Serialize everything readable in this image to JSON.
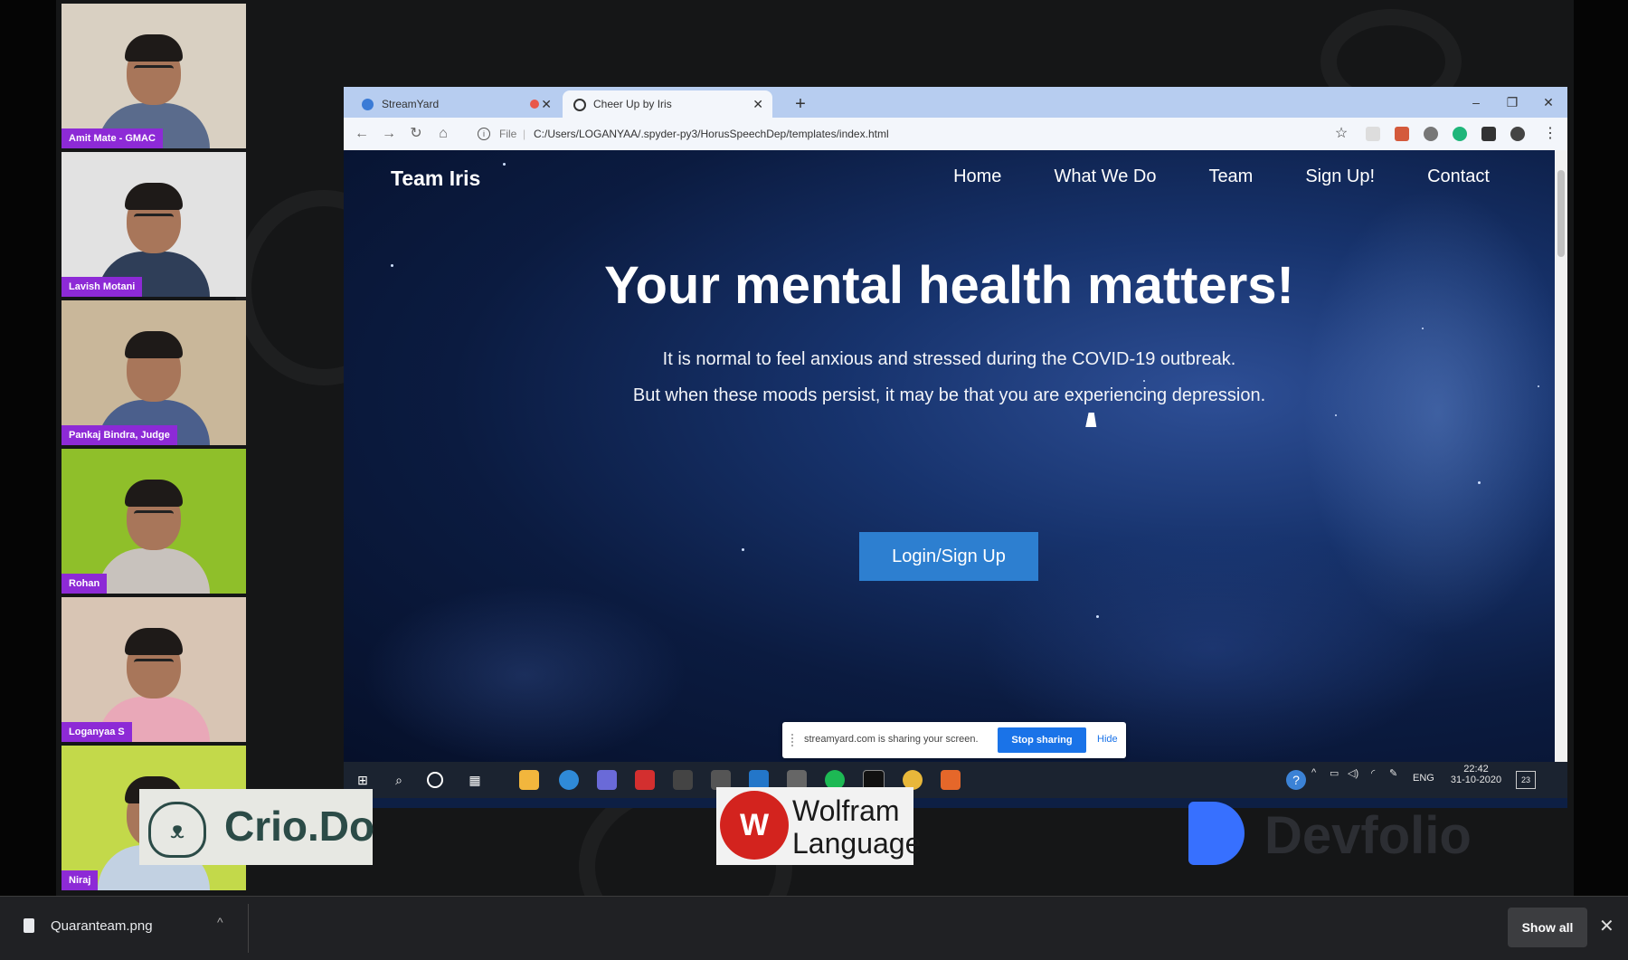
{
  "participants": [
    {
      "name": "Amit Mate - GMAC",
      "bg": "#d9d0c2",
      "shirt": "#5a6b8c"
    },
    {
      "name": "Lavish Motani",
      "bg": "#e2e2e2",
      "shirt": "#2f3e58"
    },
    {
      "name": "Pankaj Bindra, Judge",
      "bg": "#c9b79a",
      "shirt": "#4b5f8c"
    },
    {
      "name": "Rohan",
      "bg": "#8fbf2a",
      "shirt": "#c8c2bd"
    },
    {
      "name": "Loganyaa S",
      "bg": "#d8c5b4",
      "shirt": "#e9a8b8"
    },
    {
      "name": "Niraj",
      "bg": "#c3d94a",
      "shirt": "#c2d1e2"
    }
  ],
  "browser": {
    "tabs": [
      {
        "label": "StreamYard",
        "favicon_color": "#3b7bd6"
      },
      {
        "label": "Cheer Up by Iris",
        "favicon_color": "#333333"
      }
    ],
    "new_tab": "+",
    "window_buttons": {
      "minimize": "–",
      "restore": "❐",
      "close": "✕"
    },
    "nav": {
      "back": "←",
      "forward": "→",
      "reload": "↻",
      "home": "⌂"
    },
    "address": {
      "scheme": "File",
      "separator": "|",
      "url": "C:/Users/LOGANYAA/.spyder-py3/HorusSpeechDep/templates/index.html"
    },
    "star": "☆",
    "menu": "⋮"
  },
  "site": {
    "brand": "Team Iris",
    "nav": [
      "Home",
      "What We Do",
      "Team",
      "Sign Up!",
      "Contact"
    ],
    "hero_title": "Your mental health matters!",
    "hero_line1": "It is normal to feel anxious and stressed during the COVID-19 outbreak.",
    "hero_line2": "But when these moods persist, it may be that you are experiencing depression.",
    "cta": "Login/Sign Up"
  },
  "share_bar": {
    "text": "streamyard.com is sharing your screen.",
    "stop": "Stop sharing",
    "hide": "Hide"
  },
  "taskbar": {
    "language": "ENG",
    "time": "22:42",
    "date": "31-10-2020",
    "notification_count": "23"
  },
  "sponsors": {
    "crio": "Crio.Do",
    "wolfram_line1": "Wolfram",
    "wolfram_line2": "Language",
    "devfolio": "Devfolio"
  },
  "downloads": {
    "file_name": "Quaranteam.png",
    "show_all": "Show all",
    "close": "✕"
  }
}
